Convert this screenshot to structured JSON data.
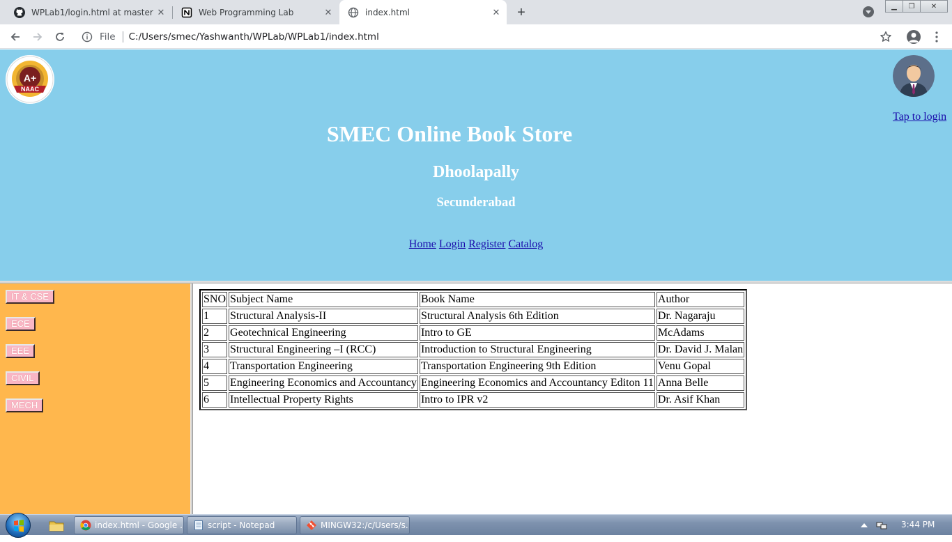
{
  "browser": {
    "tabs": [
      {
        "title": "WPLab1/login.html at master · ya",
        "icon": "github-icon",
        "active": false
      },
      {
        "title": "Web Programming Lab",
        "icon": "notion-icon",
        "active": false
      },
      {
        "title": "index.html",
        "icon": "globe-icon",
        "active": true
      }
    ],
    "new_tab_label": "+",
    "address": {
      "scheme_label": "File",
      "url": "C:/Users/smec/Yashwanth/WPLab/WPLab1/index.html"
    }
  },
  "page": {
    "header": {
      "logo_text": "A+",
      "logo_subtext": "NAAC",
      "title": "SMEC Online Book Store",
      "subtitle1": "Dhoolapally",
      "subtitle2": "Secunderabad",
      "login_link": "Tap to login",
      "nav": [
        "Home",
        "Login",
        "Register",
        "Catalog"
      ],
      "colors": {
        "header_bg": "#87ceeb",
        "sidebar_bg": "#ffb74d",
        "button_bg": "#f9b6c5",
        "link": "#1a0dab"
      }
    },
    "sidebar": {
      "buttons": [
        "IT & CSE",
        "ECE",
        "EEE",
        "CIVIL",
        "MECH"
      ]
    },
    "table": {
      "headers": [
        "SNO",
        "Subject Name",
        "Book Name",
        "Author"
      ],
      "rows": [
        [
          "1",
          "Structural Analysis-II",
          "Structural Analysis 6th Edition",
          "Dr. Nagaraju"
        ],
        [
          "2",
          "Geotechnical Engineering",
          "Intro to GE",
          "McAdams"
        ],
        [
          "3",
          "Structural Engineering –I (RCC)",
          "Introduction to Structural Engineering",
          "Dr. David J. Malan"
        ],
        [
          "4",
          "Transportation Engineering",
          "Transportation Engineering 9th Edition",
          "Venu Gopal"
        ],
        [
          "5",
          "Engineering Economics and Accountancy",
          "Engineering Economics and Accountancy Editon 11",
          "Anna Belle"
        ],
        [
          "6",
          "Intellectual Property Rights",
          "Intro to IPR v2",
          "Dr. Asif Khan"
        ]
      ]
    }
  },
  "taskbar": {
    "items": [
      {
        "label": "index.html - Google ...",
        "icon": "chrome-icon",
        "active": true
      },
      {
        "label": "script - Notepad",
        "icon": "notepad-icon",
        "active": false
      },
      {
        "label": "MINGW32:/c/Users/s...",
        "icon": "git-bash-icon",
        "active": false
      }
    ],
    "clock": "3:44 PM"
  }
}
